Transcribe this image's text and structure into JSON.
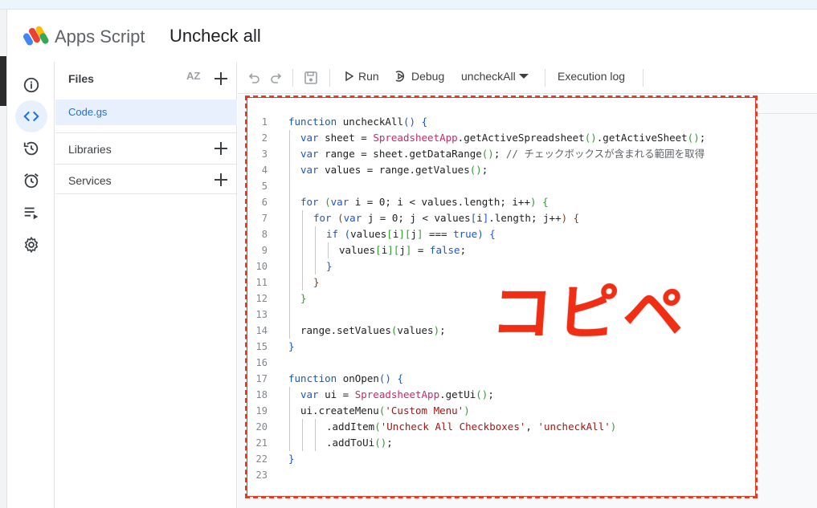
{
  "app": {
    "product_name": "Apps Script",
    "project_title": "Uncheck all"
  },
  "rail": {
    "items": [
      {
        "name": "overview",
        "icon": "info-icon"
      },
      {
        "name": "editor",
        "icon": "code-icon",
        "active": true
      },
      {
        "name": "project-history",
        "icon": "history-icon"
      },
      {
        "name": "triggers",
        "icon": "alarm-icon"
      },
      {
        "name": "executions",
        "icon": "executions-icon"
      },
      {
        "name": "project-settings",
        "icon": "gear-icon"
      }
    ]
  },
  "files_panel": {
    "title": "Files",
    "sort_label": "AZ",
    "files": [
      {
        "name": "Code.gs",
        "selected": true
      }
    ],
    "sections": [
      {
        "label": "Libraries"
      },
      {
        "label": "Services"
      }
    ]
  },
  "toolbar": {
    "run_label": "Run",
    "debug_label": "Debug",
    "function_select": "uncheckAll",
    "execution_log_label": "Execution log"
  },
  "editor": {
    "line_numbers": [
      "1",
      "2",
      "3",
      "4",
      "5",
      "6",
      "7",
      "8",
      "9",
      "10",
      "11",
      "12",
      "13",
      "14",
      "15",
      "16",
      "17",
      "18",
      "19",
      "20",
      "21",
      "22",
      "23"
    ]
  },
  "overlay_text": "コピペ",
  "colors": {
    "accent": "#1a73e8",
    "selection": "#e8f0fe",
    "annotation_red": "#ef2e14"
  }
}
